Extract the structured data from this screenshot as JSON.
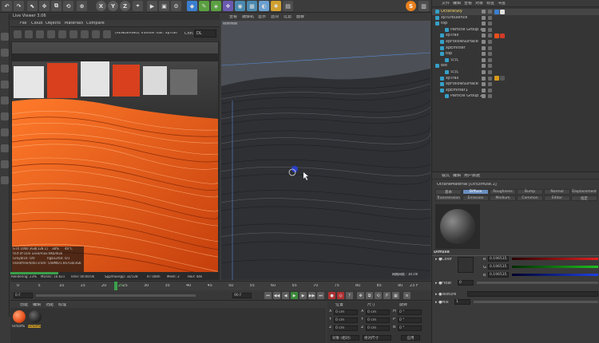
{
  "toolbar": {
    "axis_x": "X",
    "axis_y": "Y",
    "axis_z": "Z"
  },
  "live_viewer": {
    "title": "Live Viewer 3.06",
    "menu": [
      "File",
      "Cloud",
      "Objects",
      "Materials",
      "Compare"
    ],
    "status": "[RENDERING] Transfer hair: xpTrail",
    "channel_label": "Chn:",
    "channel_value": "DL",
    "hud": {
      "gpu": "GTX 1060 3GB[128.1]",
      "gpu_pct": "38%",
      "gpu_temp": "46°C",
      "ooc": "Out-of-core used/max:0Kb/4Gb",
      "grey": "Grey8/16: 0/0",
      "rgb": "Rgb32/64: 0/1",
      "vram": "Used/free/total vram: 548Mb/1.667Gb/3Gb",
      "rendering": "Rendering: 23%",
      "ms": "Ms/sec: 16.621",
      "time": "Time: 00:00:00",
      "spp": "Spp/maxspp: 32/128",
      "tri": "Tri: 0/8m",
      "mesh": "Mesh: 2",
      "hair": "Hair: 44k"
    }
  },
  "viewport": {
    "menu": [
      "查看",
      "摄像机",
      "显示",
      "选项",
      "过滤",
      "面板"
    ],
    "view_label": "透视视图",
    "grid_label": "网格间距 : 10 cm"
  },
  "timeline": {
    "ticks": [
      "0",
      "5",
      "10",
      "15",
      "20",
      "25",
      "30",
      "35",
      "40",
      "45",
      "50",
      "55",
      "60",
      "65",
      "70",
      "75",
      "80",
      "85",
      "90"
    ],
    "current_frame": "25",
    "frame_end_display": "23 F",
    "start_field": "0 F",
    "current_field": "0 F",
    "end_field": "90 F",
    "end_field2": "90 F"
  },
  "material_manager": {
    "menu": [
      "创建",
      "编辑",
      "功能",
      "纹理"
    ],
    "materials": [
      {
        "name": "OctDiffu",
        "color": "#e8501c"
      },
      {
        "name": "OctDiffu",
        "color": "#2a2a2a"
      }
    ]
  },
  "coordinates": {
    "headers": [
      "位置",
      "尺寸",
      "旋转"
    ],
    "rows": [
      {
        "axis": "X",
        "pos": "0 cm",
        "size": "0 cm",
        "rot_axis": "H",
        "rot": "0 °"
      },
      {
        "axis": "Y",
        "pos": "0 cm",
        "size": "0 cm",
        "rot_axis": "P",
        "rot": "0 °"
      },
      {
        "axis": "Z",
        "pos": "0 cm",
        "size": "0 cm",
        "rot_axis": "B",
        "rot": "0 °"
      }
    ],
    "mode_object": "对象 (相对)",
    "mode_size": "绝对尺寸",
    "apply": "应用"
  },
  "object_manager": {
    "menu": [
      "文件",
      "编辑",
      "查看",
      "对象",
      "标签",
      "书签"
    ],
    "rows": [
      {
        "name": "OctaneSky",
        "indent": 0,
        "tags": [
          "#3a7fd0",
          "#e0e0e0"
        ]
      },
      {
        "name": "xpTurbulence",
        "indent": 0,
        "tags": []
      },
      {
        "name": "top",
        "indent": 0,
        "tags": []
      },
      {
        "name": "Particle Group 1",
        "indent": 2,
        "tags": []
      },
      {
        "name": "xpTrail",
        "indent": 1,
        "tags": [
          "#e8501c",
          "#d03a2a"
        ]
      },
      {
        "name": "xpFollowSurface",
        "indent": 1,
        "tags": []
      },
      {
        "name": "xpEmitter",
        "indent": 1,
        "tags": []
      },
      {
        "name": "top",
        "indent": 1,
        "tags": []
      },
      {
        "name": "公式",
        "indent": 2,
        "tags": []
      },
      {
        "name": "bot",
        "indent": 0,
        "tags": []
      },
      {
        "name": "公式",
        "indent": 2,
        "tags": []
      },
      {
        "name": "xpTrail",
        "indent": 1,
        "tags": [
          "#d89a1a",
          "#555555"
        ]
      },
      {
        "name": "xpFollowSurface",
        "indent": 1,
        "tags": []
      },
      {
        "name": "xpEmitter1",
        "indent": 1,
        "tags": []
      },
      {
        "name": "Particle Group 2",
        "indent": 2,
        "tags": []
      }
    ]
  },
  "attributes": {
    "menu": [
      "模式",
      "编辑",
      "用户数据"
    ],
    "title": "OctaneMaterial [OctDiffuse.1]",
    "tabs_row1": [
      "基本",
      "Diffuse",
      "Roughness",
      "Bump",
      "Normal",
      "Displacement"
    ],
    "tabs_row2": [
      "Transmission",
      "Emission",
      "Medium",
      "Common",
      "Editor",
      "指定"
    ],
    "section": "Diffuse",
    "color_label": "Color",
    "r_label": "R",
    "g_label": "G",
    "b_label": "B",
    "r_value": "0.196535",
    "g_value": "0.196535",
    "b_value": "0.196535",
    "float_label": "Float",
    "float_value": "0",
    "texture_label": "Texture",
    "mix_label": "Mix",
    "mix_value": "1"
  }
}
